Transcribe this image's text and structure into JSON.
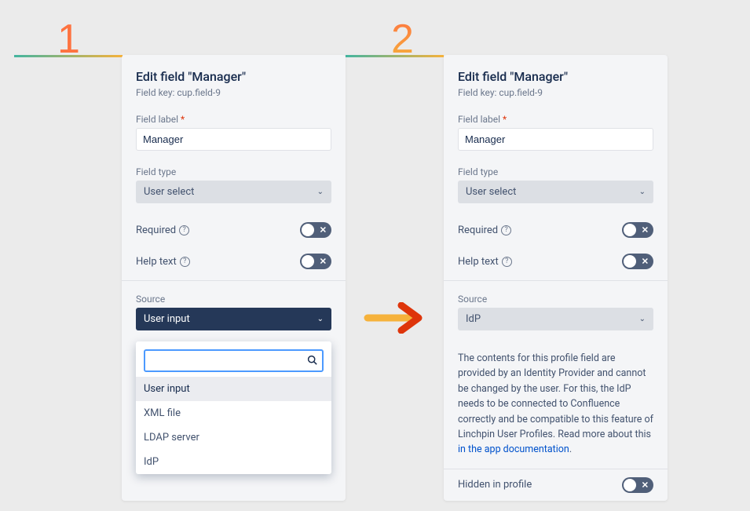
{
  "badges": {
    "one": "1",
    "two": "2"
  },
  "panel1": {
    "title": "Edit field \"Manager\"",
    "subtitle": "Field key: cup.field-9",
    "field_label_label": "Field label",
    "field_label_value": "Manager",
    "field_type_label": "Field type",
    "field_type_value": "User select",
    "required_label": "Required",
    "helptext_label": "Help text",
    "source_label": "Source",
    "source_value": "User input",
    "options": [
      "User input",
      "XML file",
      "LDAP server",
      "IdP"
    ]
  },
  "panel2": {
    "title": "Edit field \"Manager\"",
    "subtitle": "Field key: cup.field-9",
    "field_label_label": "Field label",
    "field_label_value": "Manager",
    "field_type_label": "Field type",
    "field_type_value": "User select",
    "required_label": "Required",
    "helptext_label": "Help text",
    "source_label": "Source",
    "source_value": "IdP",
    "info_text": "The contents for this profile field are provided by an Identity Provider and cannot be changed by the user. For this, the IdP needs to be connected to Confluence correctly and be compatible to this feature of Linchpin User Profiles. Read more about this ",
    "info_link": "in the app documentation",
    "hidden_label": "Hidden in profile"
  }
}
